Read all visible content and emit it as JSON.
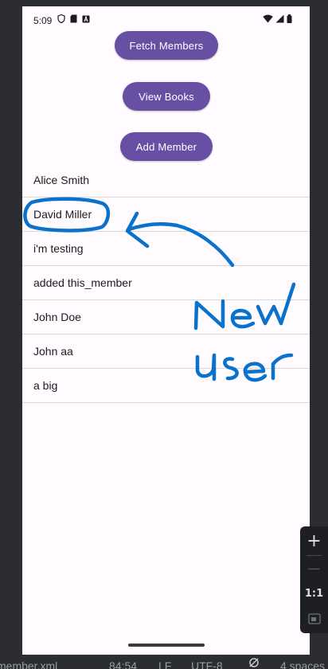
{
  "status_bar": {
    "time": "5:09"
  },
  "buttons": {
    "fetch_members": "Fetch Members",
    "view_books": "View Books",
    "add_member": "Add Member"
  },
  "members": [
    "Alice Smith",
    "David Miller",
    "i'm testing",
    "added this_member",
    "John Doe",
    "John aa",
    "a big"
  ],
  "annotation": {
    "word1": "New",
    "word2": "User",
    "color": "#0a72cc"
  },
  "theme": {
    "accent": "#6750a4",
    "background": "#fffbfe",
    "ide_background": "#2b2d30"
  },
  "zoom_controls": {
    "zoom_in": "+",
    "zoom_out": "—",
    "one_to_one": "1:1"
  },
  "ide_status_bar": {
    "file": "member.xml",
    "cursor": "84:54",
    "line_ending": "LF",
    "encoding": "UTF-8",
    "indent": "4 spaces"
  }
}
